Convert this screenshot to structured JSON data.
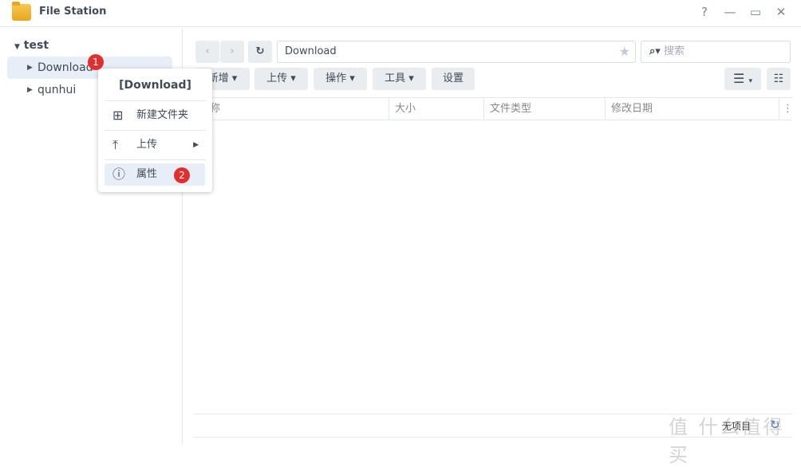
{
  "window": {
    "title": "File Station",
    "help": "?",
    "minimize": "—",
    "maximize": "▭",
    "close": "✕"
  },
  "sidebar": {
    "root": "test",
    "items": [
      {
        "label": "Download",
        "selected": true,
        "badge": "1"
      },
      {
        "label": "qunhui"
      }
    ]
  },
  "context_menu": {
    "title": "[Download]",
    "items": [
      {
        "label": "新建文件夹",
        "icon": "new-folder-icon"
      },
      {
        "label": "上传",
        "icon": "upload-icon",
        "submenu": true
      },
      {
        "label": "属性",
        "icon": "info-icon",
        "badge": "2"
      }
    ]
  },
  "nav": {
    "back": "‹",
    "forward": "›",
    "refresh": "↻",
    "path": "Download",
    "favorite": "★",
    "search_placeholder": "搜索"
  },
  "toolbar": {
    "create": "新增",
    "upload": "上传",
    "action": "操作",
    "tools": "工具",
    "settings": "设置"
  },
  "columns": [
    "名称",
    "大小",
    "文件类型",
    "修改日期"
  ],
  "footer": {
    "status": "无项目"
  },
  "watermark": "值 什么值得买",
  "colors": {
    "badge": "#e02f2f",
    "selected": "#e8eef7",
    "button": "#eaedf0"
  }
}
